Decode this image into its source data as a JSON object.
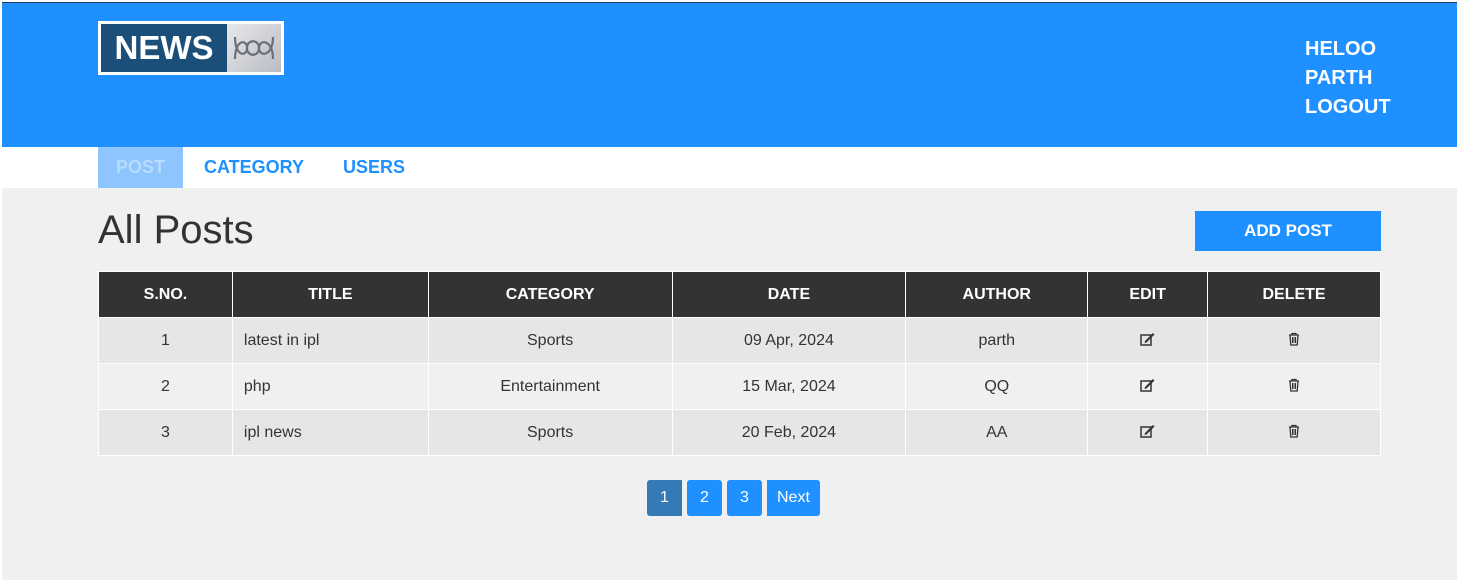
{
  "logo": {
    "text": "NEWS",
    "mark_icon": "abc-ribbon-icon"
  },
  "user_menu": {
    "greeting": "HELOO",
    "username": "PARTH",
    "logout_label": "LOGOUT"
  },
  "nav": {
    "items": [
      {
        "label": "POST",
        "active": true
      },
      {
        "label": "CATEGORY",
        "active": false
      },
      {
        "label": "USERS",
        "active": false
      }
    ]
  },
  "page": {
    "title": "All Posts",
    "add_button_label": "ADD POST"
  },
  "table": {
    "headers": [
      "S.NO.",
      "TITLE",
      "CATEGORY",
      "DATE",
      "AUTHOR",
      "EDIT",
      "DELETE"
    ],
    "rows": [
      {
        "sno": "1",
        "title": "latest in ipl",
        "category": "Sports",
        "date": "09 Apr, 2024",
        "author": "parth",
        "edit_icon": "edit-icon",
        "delete_icon": "trash-icon"
      },
      {
        "sno": "2",
        "title": "php",
        "category": "Entertainment",
        "date": "15 Mar, 2024",
        "author": "QQ",
        "edit_icon": "edit-icon",
        "delete_icon": "trash-icon"
      },
      {
        "sno": "3",
        "title": "ipl news",
        "category": "Sports",
        "date": "20 Feb, 2024",
        "author": "AA",
        "edit_icon": "edit-icon",
        "delete_icon": "trash-icon"
      }
    ]
  },
  "pagination": {
    "pages": [
      "1",
      "2",
      "3"
    ],
    "current": "1",
    "next_label": "Next"
  },
  "colors": {
    "primary": "#1e90ff",
    "dark": "#333333",
    "active_page": "#337ab7",
    "background": "#f0f0f0"
  }
}
